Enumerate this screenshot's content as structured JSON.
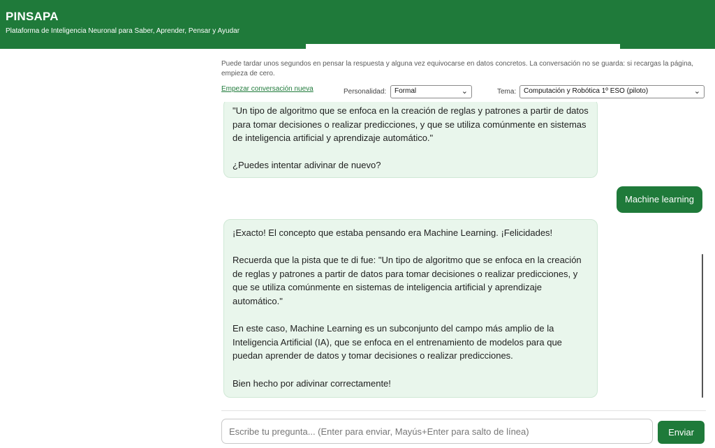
{
  "header": {
    "title": "PINSAPA",
    "subtitle": "Plataforma de Inteligencia Neuronal para Saber, Aprender, Pensar y Ayudar"
  },
  "notice": "Puede tardar unos segundos en pensar la respuesta y alguna vez equivocarse en datos concretos. La conversación no se guarda: si recargas la página, empieza de cero.",
  "toolbar": {
    "new_conversation": "Empezar conversación nueva",
    "personality_label": "Personalidad:",
    "personality_value": "Formal",
    "topic_label": "Tema:",
    "topic_value": "Computación y Robótica 1º ESO (piloto)"
  },
  "messages": [
    {
      "role": "assistant",
      "paragraphs": [
        "\"Un tipo de algoritmo que se enfoca en la creación de reglas y patrones a partir de datos para tomar decisiones o realizar predicciones, y que se utiliza comúnmente en sistemas de inteligencia artificial y aprendizaje automático.\"",
        "¿Puedes intentar adivinar de nuevo?"
      ]
    },
    {
      "role": "user",
      "text": "Machine learning"
    },
    {
      "role": "assistant",
      "paragraphs": [
        "¡Exacto! El concepto que estaba pensando era Machine Learning. ¡Felicidades!",
        "Recuerda que la pista que te di fue: \"Un tipo de algoritmo que se enfoca en la creación de reglas y patrones a partir de datos para tomar decisiones o realizar predicciones, y que se utiliza comúnmente en sistemas de inteligencia artificial y aprendizaje automático.\"",
        "En este caso, Machine Learning es un subconjunto del campo más amplio de la Inteligencia Artificial (IA), que se enfoca en el entrenamiento de modelos para que puedan aprender de datos y tomar decisiones o realizar predicciones.",
        "Bien hecho por adivinar correctamente!"
      ]
    }
  ],
  "composer": {
    "placeholder": "Escribe tu pregunta... (Enter para enviar, Mayús+Enter para salto de línea)",
    "send_label": "Enviar"
  },
  "icons": {
    "select_chevron": "chevron-down-icon"
  },
  "colors": {
    "brand_green": "#1f7a3a",
    "bot_bubble": "#e9f6ec"
  }
}
